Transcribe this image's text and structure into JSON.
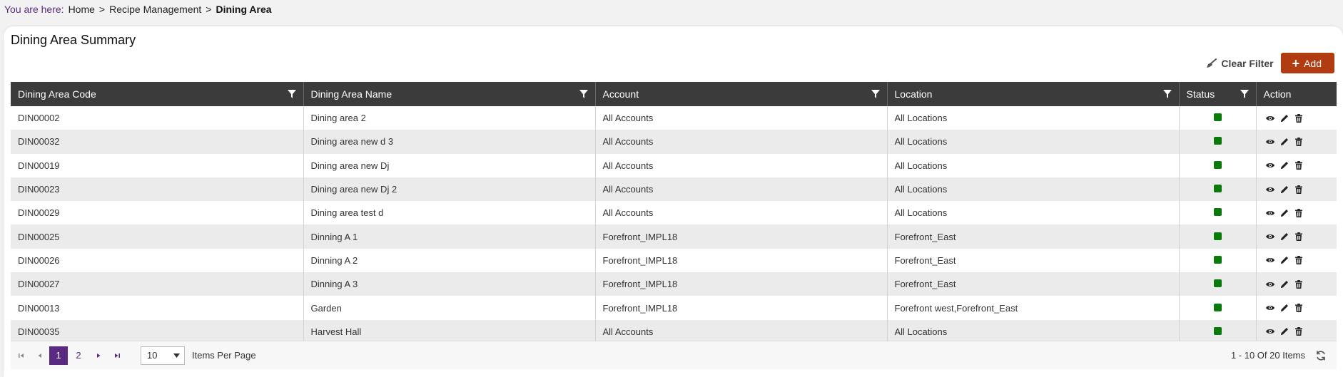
{
  "breadcrumb": {
    "prefix": "You are here:",
    "home": "Home",
    "section": "Recipe Management",
    "current": "Dining Area",
    "separator": ">"
  },
  "panel": {
    "title": "Dining Area Summary"
  },
  "toolbar": {
    "clear_filter_label": "Clear Filter",
    "add_label": "Add"
  },
  "table": {
    "columns": [
      "Dining Area Code",
      "Dining Area Name",
      "Account",
      "Location",
      "Status",
      "Action"
    ],
    "rows": [
      {
        "code": "DIN00002",
        "name": "Dining area 2",
        "account": "All Accounts",
        "location": "All Locations",
        "status": "active"
      },
      {
        "code": "DIN00032",
        "name": "Dining area new d 3",
        "account": "All Accounts",
        "location": "All Locations",
        "status": "active"
      },
      {
        "code": "DIN00019",
        "name": "Dining area new Dj",
        "account": "All Accounts",
        "location": "All Locations",
        "status": "active"
      },
      {
        "code": "DIN00023",
        "name": "Dining area new Dj 2",
        "account": "All Accounts",
        "location": "All Locations",
        "status": "active"
      },
      {
        "code": "DIN00029",
        "name": "Dining area test d",
        "account": "All Accounts",
        "location": "All Locations",
        "status": "active"
      },
      {
        "code": "DIN00025",
        "name": "Dinning A 1",
        "account": "Forefront_IMPL18",
        "location": "Forefront_East",
        "status": "active"
      },
      {
        "code": "DIN00026",
        "name": "Dinning A 2",
        "account": "Forefront_IMPL18",
        "location": "Forefront_East",
        "status": "active"
      },
      {
        "code": "DIN00027",
        "name": "Dinning A 3",
        "account": "Forefront_IMPL18",
        "location": "Forefront_East",
        "status": "active"
      },
      {
        "code": "DIN00013",
        "name": "Garden",
        "account": "Forefront_IMPL18",
        "location": "Forefront west,Forefront_East",
        "status": "active"
      },
      {
        "code": "DIN00035",
        "name": "Harvest Hall",
        "account": "All Accounts",
        "location": "All Locations",
        "status": "active"
      }
    ]
  },
  "pager": {
    "pages": [
      "1",
      "2"
    ],
    "current_page": "1",
    "per_page": "10",
    "per_page_label": "Items Per Page",
    "info": "1 - 10 Of 20 Items"
  },
  "colors": {
    "accent": "#5a2a82",
    "add_button": "#b13c12",
    "header_bg": "#3b3b3b",
    "status_active": "#0a7a0a"
  },
  "icons": {
    "filter": "funnel-icon",
    "view": "eye-icon",
    "edit": "pencil-icon",
    "delete": "trash-icon",
    "clear_filter": "broom-icon",
    "refresh": "refresh-icon"
  }
}
